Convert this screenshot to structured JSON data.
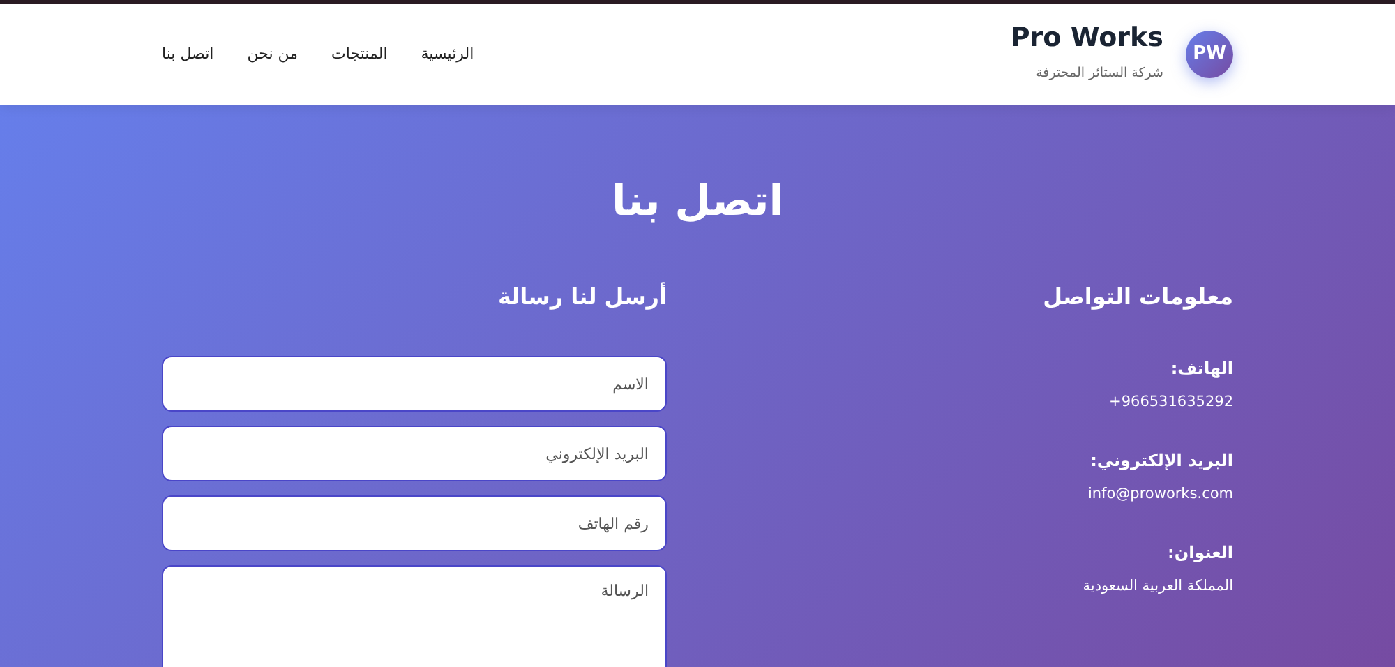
{
  "brand": {
    "logo": "PW",
    "name": "Pro Works",
    "tagline": "شركة الستائر المحترفة"
  },
  "nav": [
    {
      "label": "الرئيسية"
    },
    {
      "label": "المنتجات"
    },
    {
      "label": "من نحن"
    },
    {
      "label": "اتصل بنا"
    }
  ],
  "page_title": "اتصل بنا",
  "contact_info": {
    "heading": "معلومات التواصل",
    "items": [
      {
        "label": "الهاتف:",
        "value": "966531635292+"
      },
      {
        "label": "البريد الإلكتروني:",
        "value": "info@proworks.com"
      },
      {
        "label": "العنوان:",
        "value": "المملكة العربية السعودية"
      }
    ]
  },
  "form": {
    "heading": "أرسل لنا رسالة",
    "fields": [
      {
        "kind": "input",
        "placeholder": "الاسم"
      },
      {
        "kind": "input",
        "placeholder": "البريد الإلكتروني"
      },
      {
        "kind": "input",
        "placeholder": "رقم الهاتف"
      },
      {
        "kind": "textarea",
        "placeholder": "الرسالة"
      }
    ]
  }
}
